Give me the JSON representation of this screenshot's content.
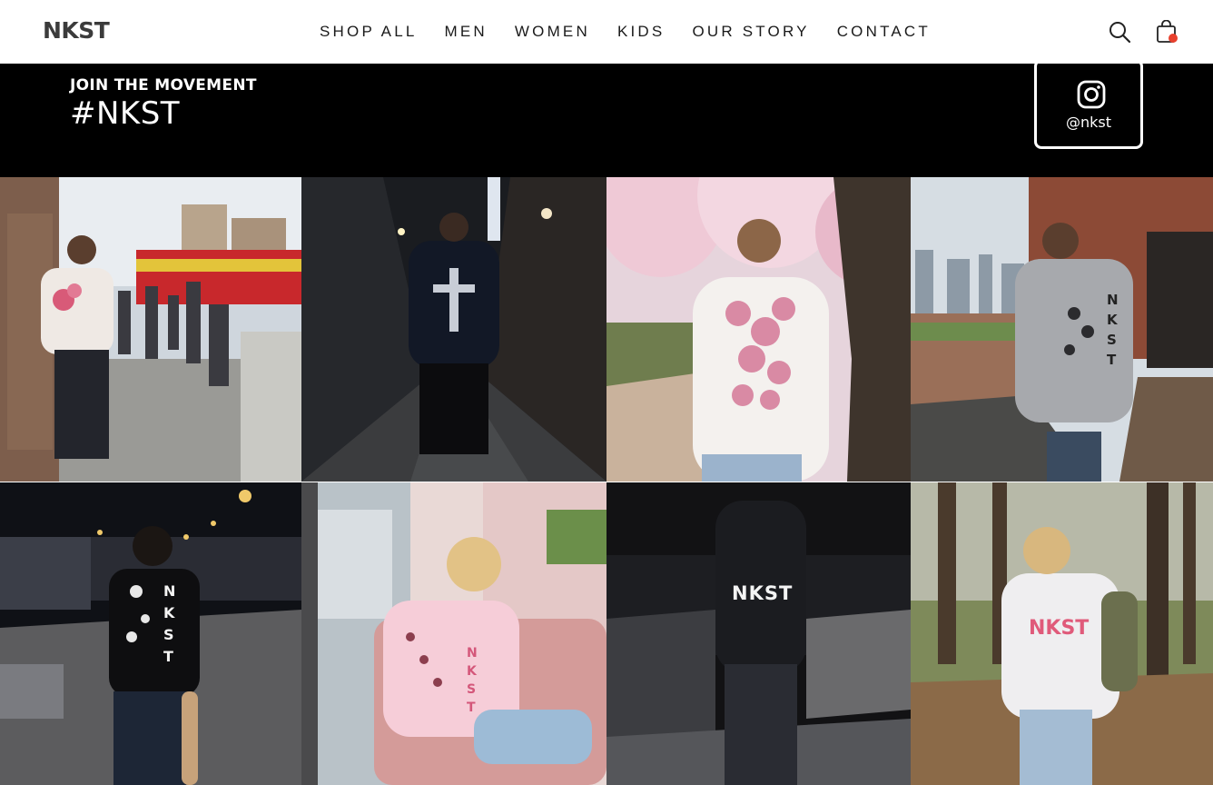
{
  "brand": {
    "logo_text": "NKST"
  },
  "nav": {
    "items": [
      "SHOP ALL",
      "MEN",
      "WOMEN",
      "KIDS",
      "OUR STORY",
      "CONTACT"
    ]
  },
  "header_icons": {
    "search": "search-icon",
    "cart": "shopping-bag-icon",
    "cart_badge_color": "#e8412e"
  },
  "banner": {
    "kicker": "JOIN THE MOVEMENT",
    "hashtag": "#NKST",
    "instagram": {
      "icon": "instagram-icon",
      "handle": "@nkst"
    }
  },
  "gallery": {
    "photos": [
      {
        "subject": "Man in white sweatshirt with cherry blossom print leaning on graffiti wall at train station"
      },
      {
        "subject": "Man in black sweatshirt with cross print in a dark wet alley"
      },
      {
        "subject": "Woman in white sweatshirt with pink petal print under cherry blossoms"
      },
      {
        "subject": "Man in grey NKST tee on a rooftop terrace with city skyline"
      },
      {
        "subject": "Man in black NKST tee holding skateboard at night skatepark"
      },
      {
        "subject": "Woman in pink NKST sweatshirt sitting on pink sofa by window"
      },
      {
        "subject": "Person in black NKST hoodie at night skatepark"
      },
      {
        "subject": "Woman in white NKST hoodie with backpack in autumn park"
      }
    ],
    "prints": {
      "tee_grey": "NKST",
      "tee_black": "NKST",
      "sweat_pink": "NKST",
      "hoodie_black": "NKST",
      "hoodie_white": "NKST"
    }
  }
}
